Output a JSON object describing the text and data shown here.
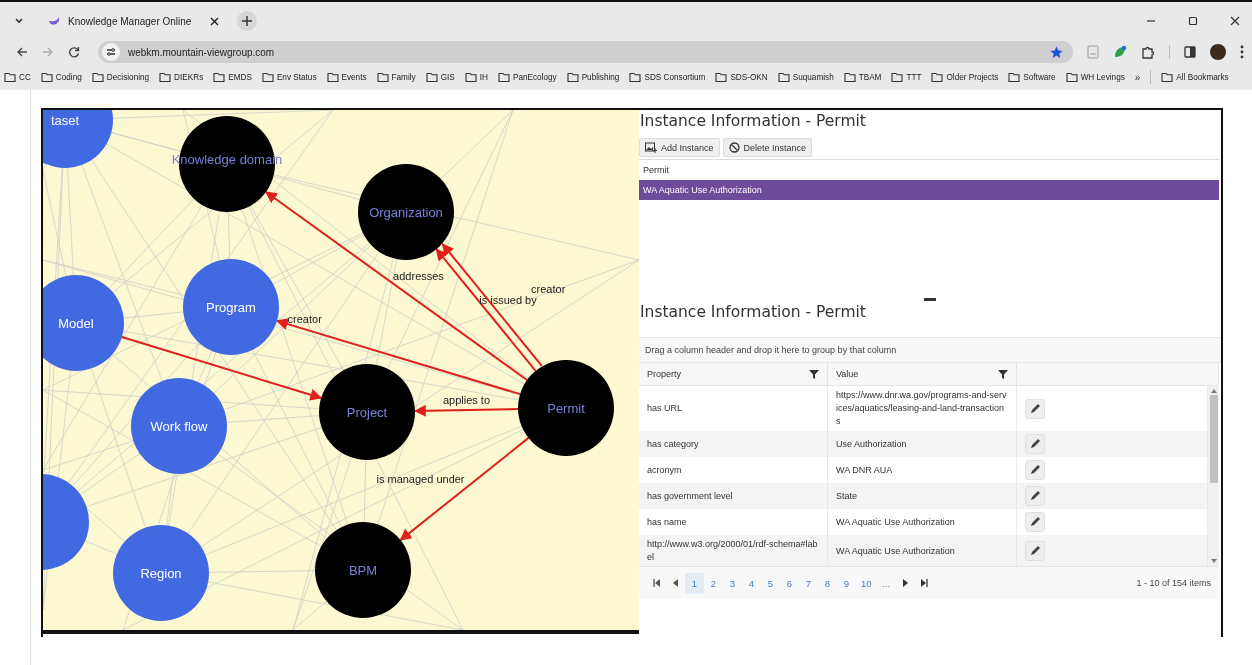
{
  "browser": {
    "tab_title": "Knowledge Manager Online",
    "url": "webkm.mountain-viewgroup.com",
    "bookmarks": [
      "CC",
      "Coding",
      "Decisioning",
      "DIEKRs",
      "EMDS",
      "Env Status",
      "Events",
      "Family",
      "GIS",
      "IH",
      "PanEcology",
      "Publishing",
      "SDS Consortium",
      "SDS-OKN",
      "Suquamish",
      "TBAM",
      "TTT",
      "Older Projects",
      "Software",
      "WH Levings"
    ],
    "overflow": "»",
    "all_bookmarks": "All Bookmarks"
  },
  "graph": {
    "nodes": [
      {
        "label": "taset",
        "color": "#4169e1"
      },
      {
        "label": "Knowledge domain",
        "color": "#000000"
      },
      {
        "label": "Organization",
        "color": "#000000"
      },
      {
        "label": "Program",
        "color": "#4169e1"
      },
      {
        "label": "Model",
        "color": "#4169e1"
      },
      {
        "label": "Work flow",
        "color": "#4169e1"
      },
      {
        "label": "Project",
        "color": "#000000"
      },
      {
        "label": "Permit",
        "color": "#000000"
      },
      {
        "color": "#4169e1"
      },
      {
        "label": "Region",
        "color": "#4169e1"
      },
      {
        "label": "BPM",
        "color": "#000000"
      }
    ],
    "edges": [
      {
        "label": "addresses"
      },
      {
        "label": "is issued by"
      },
      {
        "label": "creator"
      },
      {
        "label": "creator"
      },
      {
        "label": "applies to"
      },
      {
        "label": "is managed under"
      }
    ]
  },
  "instance_list": {
    "title": "Instance Information - Permit",
    "buttons": [
      {
        "kind": "add",
        "label": "Add Instance"
      },
      {
        "kind": "delete",
        "label": "Delete Instance"
      }
    ],
    "column": "Permit",
    "rows": [
      {
        "label": "WA Aquatic Use Authorization",
        "selected": true
      }
    ]
  },
  "properties": {
    "title": "Instance Information - Permit",
    "group_hint": "Drag a column header and drop it here to group by that column",
    "columns": [
      "Property",
      "Value"
    ],
    "rows": [
      {
        "property": "has URL",
        "value": "https://www.dnr.wa.gov/programs-and-services/aquatics/leasing-and-land-transactions"
      },
      {
        "property": "has category",
        "value": "Use Authorization"
      },
      {
        "property": "acronym",
        "value": "WA DNR AUA"
      },
      {
        "property": "has government level",
        "value": "State"
      },
      {
        "property": "has name",
        "value": "WA Aquatic Use Authorization"
      },
      {
        "property": "http://www.w3.org/2000/01/rdf-schema#label",
        "value": "WA Aquatic Use Authorization"
      }
    ],
    "pagination": {
      "pages": [
        {
          "label": "1",
          "selected": true
        },
        {
          "label": "2",
          "selected": false
        },
        {
          "label": "3",
          "selected": false
        },
        {
          "label": "4",
          "selected": false
        },
        {
          "label": "5",
          "selected": false
        },
        {
          "label": "6",
          "selected": false
        },
        {
          "label": "7",
          "selected": false
        },
        {
          "label": "8",
          "selected": false
        },
        {
          "label": "9",
          "selected": false
        },
        {
          "label": "10",
          "selected": false
        }
      ],
      "ellipsis": "...",
      "summary": "1 - 10 of 154 items"
    }
  }
}
